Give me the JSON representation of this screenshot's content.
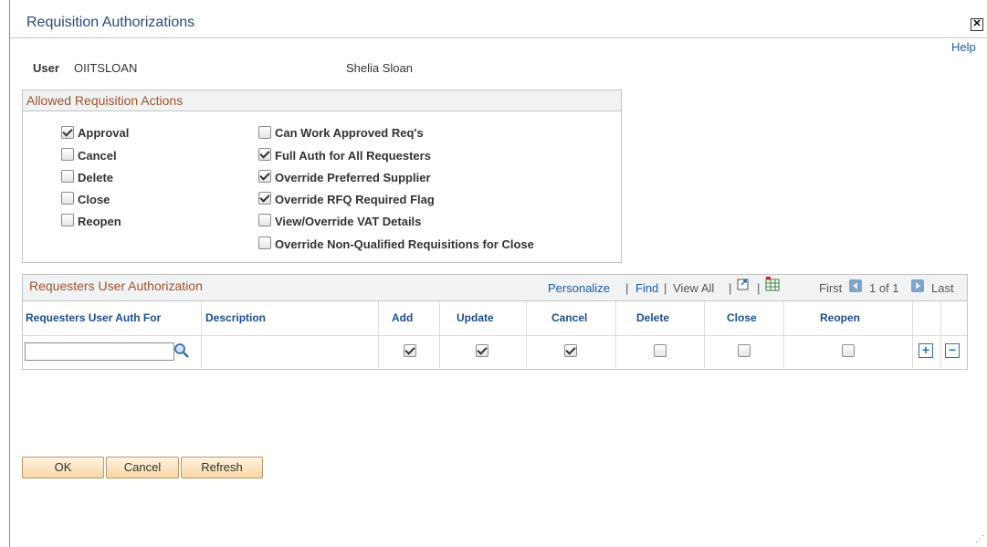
{
  "window": {
    "title": "Requisition Authorizations",
    "help_label": "Help",
    "close_icon": "close-icon"
  },
  "user": {
    "label": "User",
    "id": "OIITSLOAN",
    "name": "Shelia Sloan"
  },
  "allowed_actions": {
    "title": "Allowed Requisition Actions",
    "left": [
      {
        "label": "Approval",
        "checked": true
      },
      {
        "label": "Cancel",
        "checked": false
      },
      {
        "label": "Delete",
        "checked": false
      },
      {
        "label": "Close",
        "checked": false
      },
      {
        "label": "Reopen",
        "checked": false
      }
    ],
    "right": [
      {
        "label": "Can Work Approved Req's",
        "checked": false
      },
      {
        "label": "Full Auth for All Requesters",
        "checked": true
      },
      {
        "label": "Override Preferred Supplier",
        "checked": true
      },
      {
        "label": "Override RFQ Required Flag",
        "checked": true
      },
      {
        "label": "View/Override VAT Details",
        "checked": false
      },
      {
        "label": "Override Non-Qualified Requisitions for Close",
        "checked": false
      }
    ]
  },
  "grid": {
    "title": "Requesters User Authorization",
    "personalize": "Personalize",
    "find": "Find",
    "view_all": "View All",
    "first": "First",
    "range": "1 of 1",
    "last": "Last",
    "columns": [
      "Requesters User Auth For",
      "Description",
      "Add",
      "Update",
      "Cancel",
      "Delete",
      "Close",
      "Reopen"
    ],
    "row": {
      "requester_value": "",
      "description": "",
      "add": true,
      "update": true,
      "cancel": true,
      "delete": false,
      "close": false,
      "reopen": false
    }
  },
  "buttons": {
    "ok": "OK",
    "cancel": "Cancel",
    "refresh": "Refresh"
  }
}
